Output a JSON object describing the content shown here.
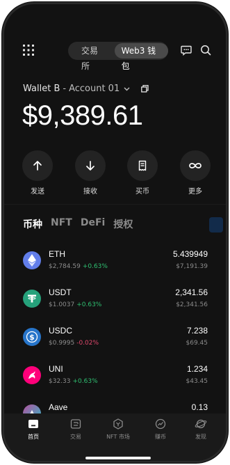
{
  "header": {
    "segments": [
      "交易所",
      "Web3 钱包"
    ],
    "active_segment": "Web3 钱包"
  },
  "account": {
    "wallet": "Wallet B",
    "separator": "-",
    "name": "Account 01"
  },
  "balance": "$9,389.61",
  "actions": [
    {
      "label": "发送",
      "icon": "arrow-up-icon"
    },
    {
      "label": "接收",
      "icon": "arrow-down-icon"
    },
    {
      "label": "买币",
      "icon": "receipt-icon"
    },
    {
      "label": "更多",
      "icon": "infinity-icon"
    }
  ],
  "tabs": [
    "币种",
    "NFT",
    "DeFi",
    "授权"
  ],
  "active_tab": "币种",
  "assets": [
    {
      "symbol": "ETH",
      "price": "$2,784.59",
      "change": "+0.63%",
      "direction": "up",
      "amount": "5.439949",
      "value": "$7,191.39",
      "color": "#627eea"
    },
    {
      "symbol": "USDT",
      "price": "$1.0037",
      "change": "+0.63%",
      "direction": "up",
      "amount": "2,341.56",
      "value": "$2,341.56",
      "color": "#26a17b"
    },
    {
      "symbol": "USDC",
      "price": "$0.9995",
      "change": "-0.02%",
      "direction": "down",
      "amount": "7.238",
      "value": "$69.45",
      "color": "#2775ca"
    },
    {
      "symbol": "UNI",
      "price": "$32.33",
      "change": "+0.63%",
      "direction": "up",
      "amount": "1.234",
      "value": "$43.45",
      "color": "#ff007a"
    },
    {
      "symbol": "Aave",
      "price": "",
      "change": "",
      "direction": "up",
      "amount": "0.13",
      "value": "",
      "color": "#8a5cd8"
    }
  ],
  "bottom_nav": [
    {
      "label": "首页",
      "icon": "home-icon",
      "active": true
    },
    {
      "label": "交易",
      "icon": "trade-icon",
      "active": false
    },
    {
      "label": "NFT 市场",
      "icon": "nft-market-icon",
      "active": false
    },
    {
      "label": "赚币",
      "icon": "earn-icon",
      "active": false
    },
    {
      "label": "发现",
      "icon": "discover-icon",
      "active": false
    }
  ],
  "colors": {
    "background": "#121212",
    "up": "#2fbf71",
    "down": "#e0486d"
  }
}
